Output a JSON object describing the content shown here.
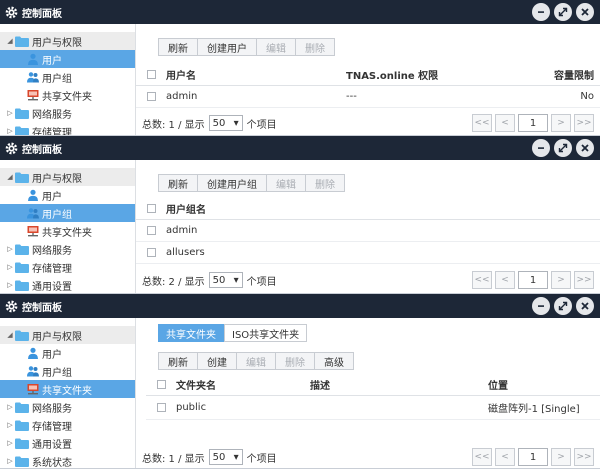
{
  "window_title": "控制面板",
  "tree": {
    "users_perms": "用户与权限",
    "user": "用户",
    "group": "用户组",
    "shared": "共享文件夹",
    "network": "网络服务",
    "storage": "存储管理",
    "general": "通用设置",
    "status": "系统状态"
  },
  "panel1": {
    "toolbar": [
      "刷新",
      "创建用户",
      "编辑",
      "删除"
    ],
    "headers": [
      "用户名",
      "TNAS.online 权限",
      "容量限制"
    ],
    "rows": [
      {
        "name": "admin",
        "tnas": "---",
        "quota": "No"
      }
    ],
    "pager": {
      "total_label": "总数: 1 / 显示",
      "per_page": "50",
      "items_label": "个项目",
      "page": "1"
    }
  },
  "panel2": {
    "toolbar": [
      "刷新",
      "创建用户组",
      "编辑",
      "删除"
    ],
    "headers": [
      "用户组名"
    ],
    "rows": [
      "admin",
      "allusers"
    ],
    "pager": {
      "total_label": "总数: 2 / 显示",
      "per_page": "50",
      "items_label": "个项目",
      "page": "1"
    }
  },
  "panel3": {
    "tabs": [
      "共享文件夹",
      "ISO共享文件夹"
    ],
    "toolbar": [
      "刷新",
      "创建",
      "编辑",
      "删除",
      "高级"
    ],
    "headers": [
      "文件夹名",
      "描述",
      "位置"
    ],
    "rows": [
      {
        "name": "public",
        "desc": "",
        "loc": "磁盘阵列-1 [Single]"
      }
    ],
    "pager": {
      "total_label": "总数: 1 / 显示",
      "per_page": "50",
      "items_label": "个项目",
      "page": "1"
    }
  },
  "pager_buttons": {
    "first": "<<",
    "prev": "<",
    "next": ">",
    "last": ">>"
  },
  "colors": {
    "titlebar": "#1d2737",
    "selected": "#5aa6e5",
    "folder": "#5bb3ea"
  }
}
